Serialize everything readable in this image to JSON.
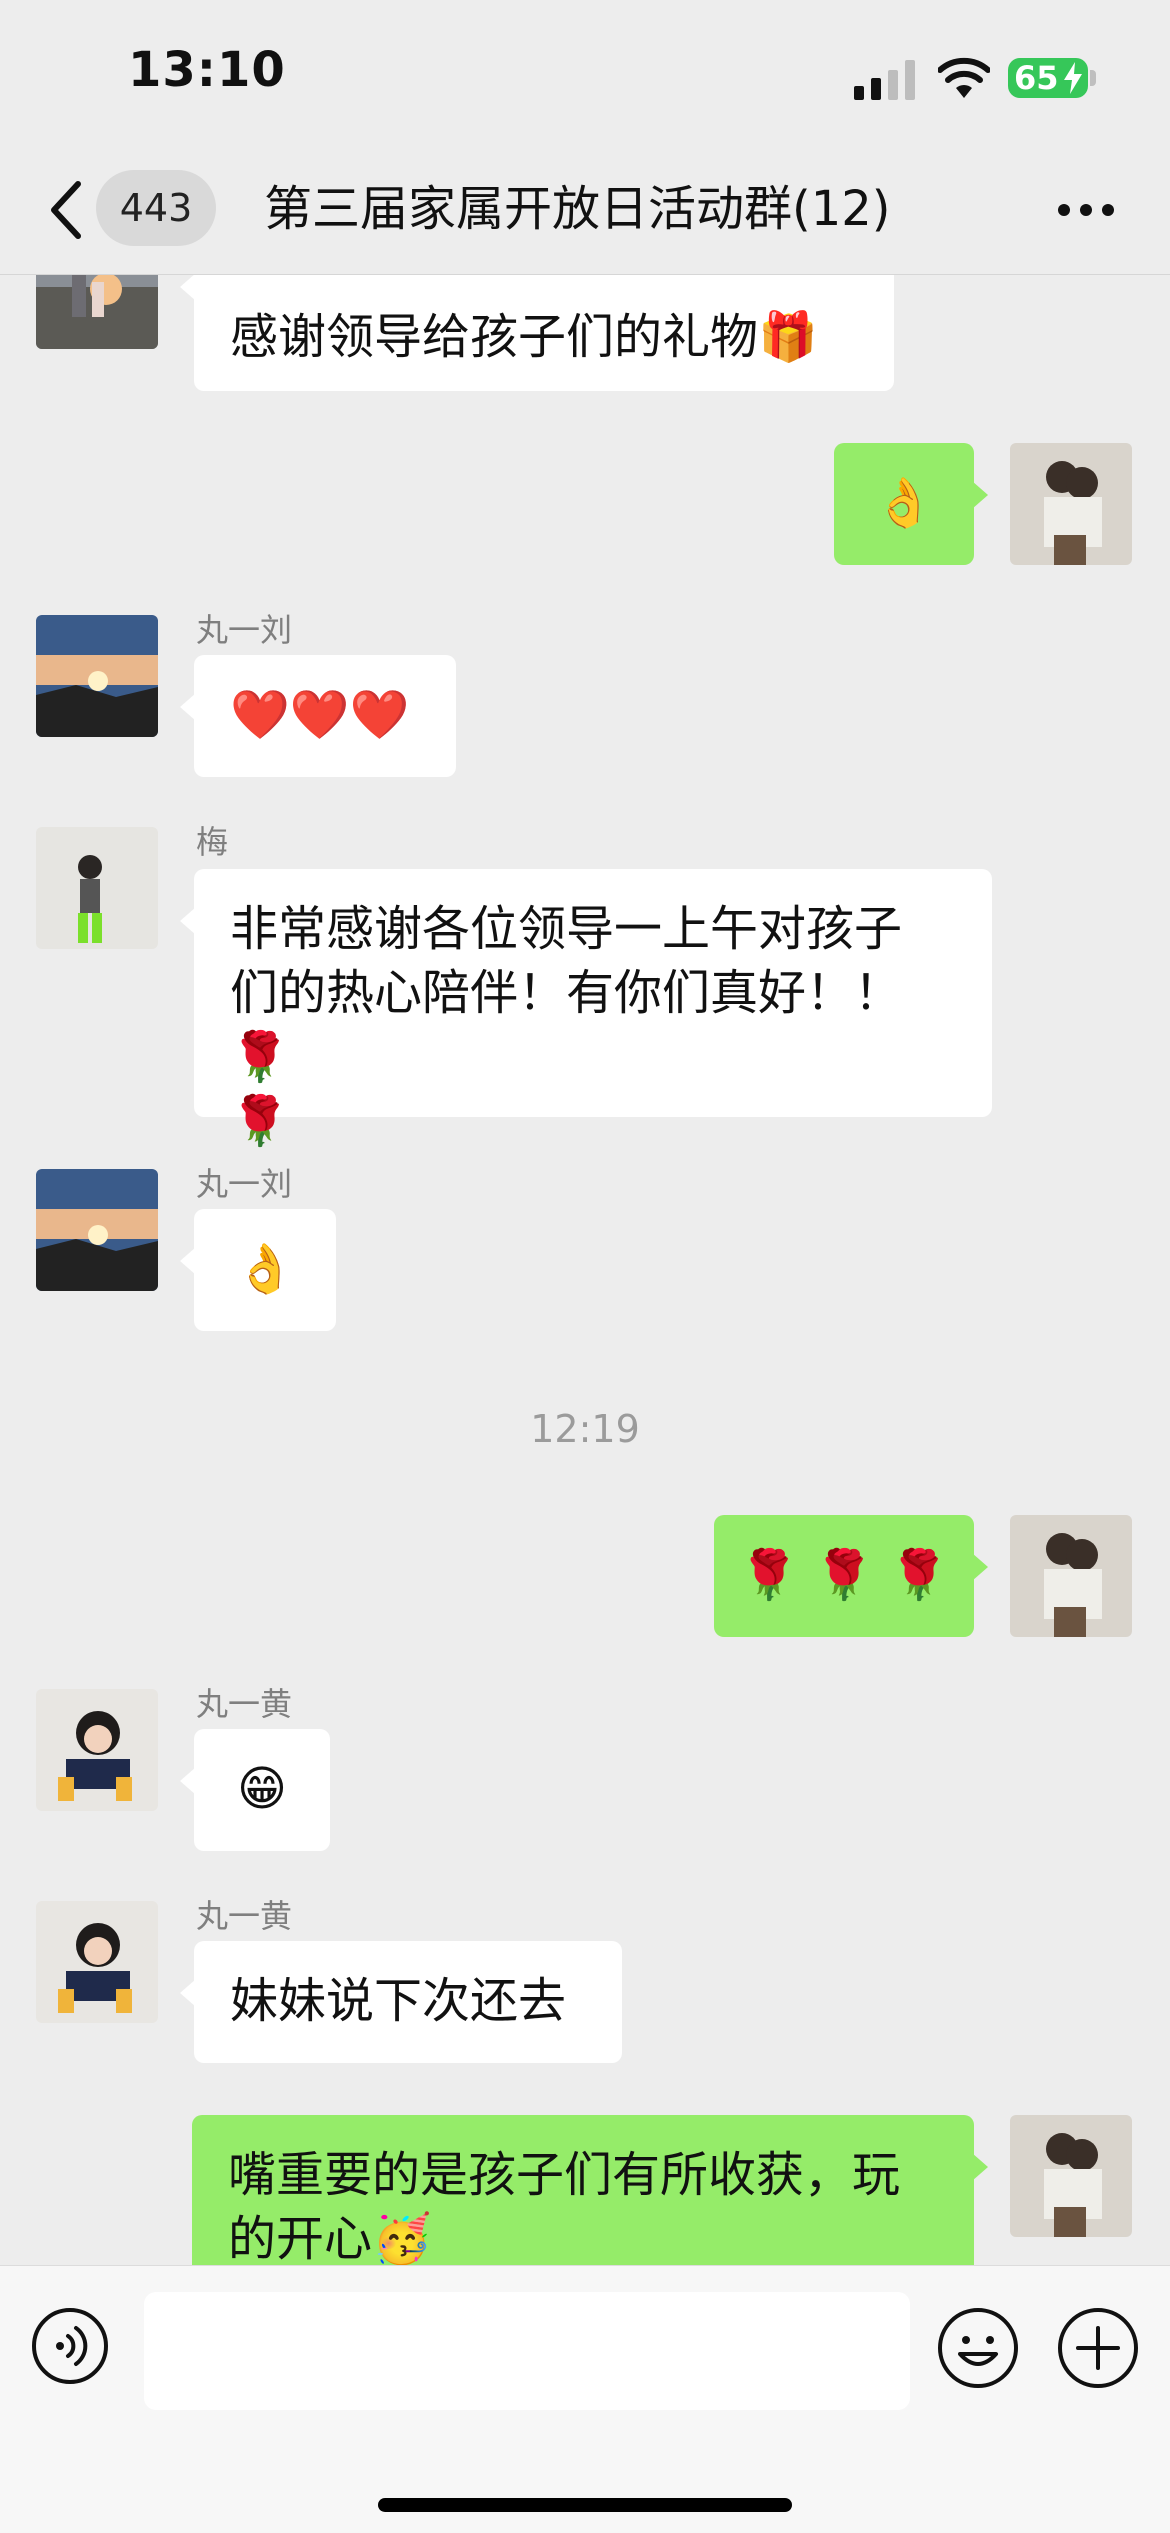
{
  "status_bar": {
    "time": "13:10",
    "battery": "65",
    "icons": [
      "cellular-signal-icon",
      "wifi-icon",
      "battery-charging-icon"
    ]
  },
  "nav": {
    "back_icon": "chevron-left-icon",
    "unread_count": "443",
    "title": "第三届家属开放日活动群(12)",
    "more_icon": "more-dots-icon"
  },
  "messages": [
    {
      "direction": "in",
      "sender": "",
      "text": "感谢领导给孩子们的礼物🎁"
    },
    {
      "direction": "out",
      "text": "👌"
    },
    {
      "direction": "in",
      "sender": "丸一刘",
      "text": "❤️❤️❤️"
    },
    {
      "direction": "in",
      "sender": "梅",
      "text_line1": "非常感谢各位领导一上午对孩子",
      "text_line2": "们的热心陪伴！有你们真好！！🌹",
      "text_line3": "🌹"
    },
    {
      "direction": "in",
      "sender": "丸一刘",
      "text": "👌"
    },
    {
      "direction": "out",
      "text": "🌹 🌹 🌹"
    },
    {
      "direction": "in",
      "sender": "丸一黄",
      "text": "😁"
    },
    {
      "direction": "in",
      "sender": "丸一黄",
      "text": "妹妹说下次还去"
    },
    {
      "direction": "out",
      "text_line1": "嘴重要的是孩子们有所收获，玩",
      "text_line2": "的开心🥳"
    }
  ],
  "timestamp": "12:19",
  "input_bar": {
    "placeholder": "",
    "icons": [
      "voice-icon",
      "emoji-icon",
      "plus-icon"
    ]
  },
  "colors": {
    "background": "#ededed",
    "outgoing_bubble": "#95ec69",
    "incoming_bubble": "#ffffff",
    "battery": "#36c759"
  }
}
